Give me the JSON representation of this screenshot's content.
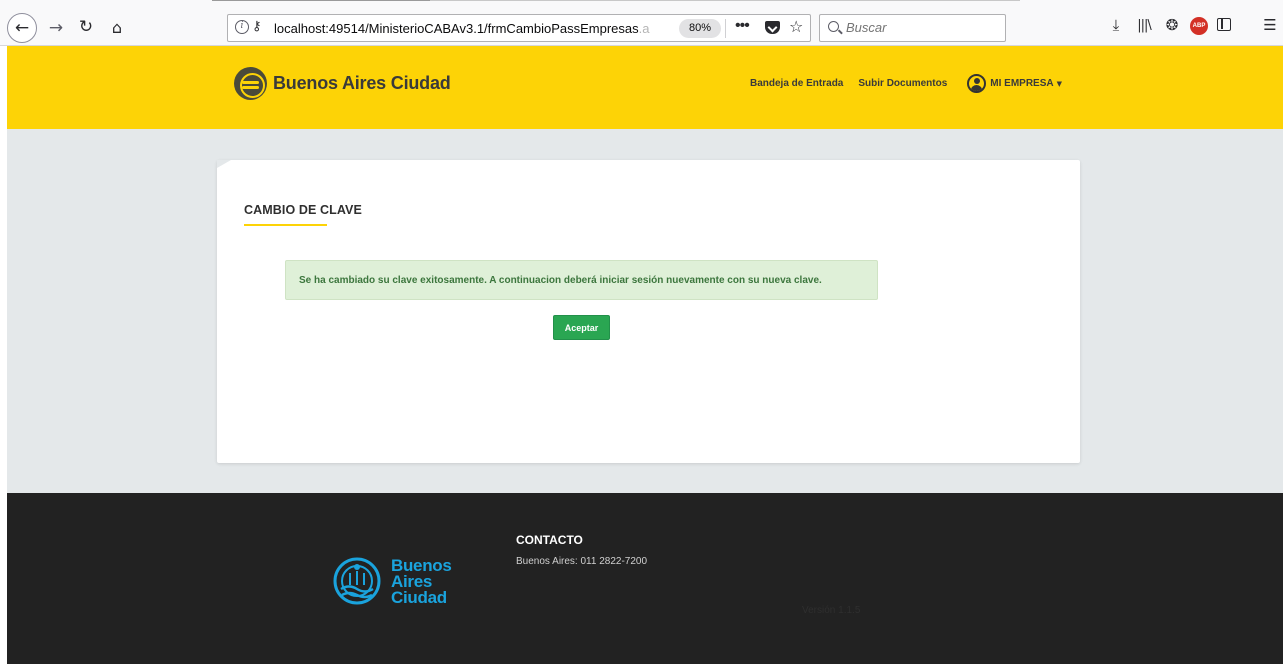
{
  "browser": {
    "url_main": "localhost:49514/MinisterioCABAv3.1/frmCambioPassEmpresas",
    "url_faded": ".a",
    "zoom": "80%",
    "search_placeholder": "Buscar",
    "abp_label": "ABP"
  },
  "header": {
    "brand_name": "Buenos Aires Ciudad",
    "nav": {
      "inbox": "Bandeja de Entrada",
      "upload": "Subir Documentos",
      "user": "MI EMPRESA"
    },
    "accent_color": "#fdd306"
  },
  "main": {
    "title": "CAMBIO DE CLAVE",
    "alert_message": "Se ha cambiado su clave exitosamente. A continuacion deberá iniciar sesión nuevamente con su nueva clave.",
    "accept_label": "Aceptar",
    "success_color": "#2aa652"
  },
  "footer": {
    "logo_lines": [
      "Buenos",
      "Aires",
      "Ciudad"
    ],
    "contact_title": "CONTACTO",
    "contact_phone": "Buenos Aires: 011 2822-7200",
    "version": "Versión 1.1.5",
    "logo_color": "#1aa3dd"
  }
}
